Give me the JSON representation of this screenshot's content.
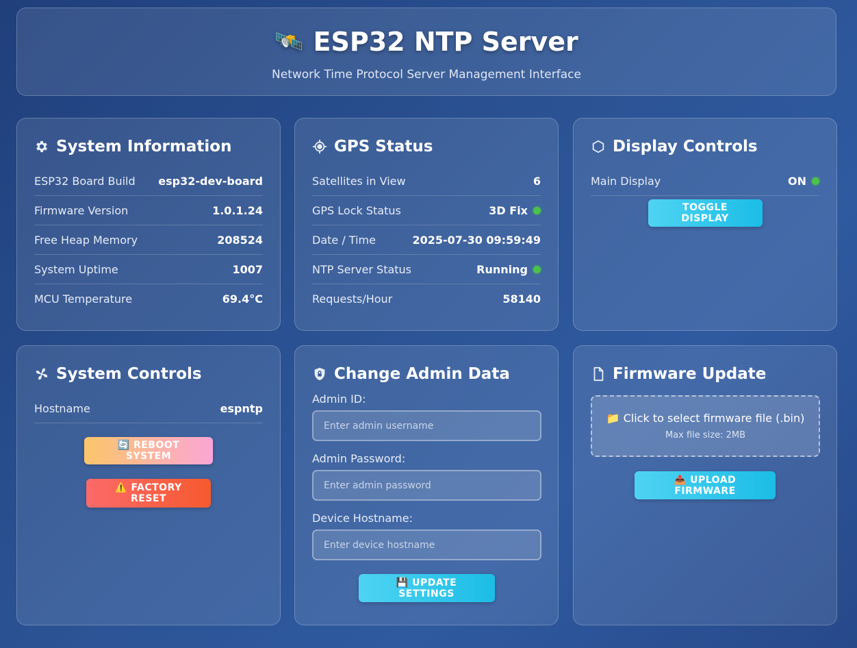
{
  "header": {
    "title": "ESP32 NTP Server",
    "icon": "satellite-icon",
    "subtitle": "Network Time Protocol Server Management Interface"
  },
  "system_info": {
    "title": "System Information",
    "icon": "gear-icon",
    "rows": [
      {
        "label": "ESP32 Board Build",
        "value": "esp32-dev-board"
      },
      {
        "label": "Firmware Version",
        "value": "1.0.1.24"
      },
      {
        "label": "Free Heap Memory",
        "value": "208524"
      },
      {
        "label": "System Uptime",
        "value": "1007"
      },
      {
        "label": "MCU Temperature",
        "value": "69.4°C"
      }
    ]
  },
  "gps_status": {
    "title": "GPS Status",
    "icon": "crosshair-icon",
    "rows": [
      {
        "label": "Satellites in View",
        "value": "6"
      },
      {
        "label": "GPS Lock Status",
        "value": "3D Fix",
        "status": "green"
      },
      {
        "label": "Date / Time",
        "value": "2025-07-30 09:59:49"
      },
      {
        "label": "NTP Server Status",
        "value": "Running",
        "status": "green"
      },
      {
        "label": "Requests/Hour",
        "value": "58140"
      }
    ]
  },
  "display_controls": {
    "title": "Display Controls",
    "icon": "hexagon-icon",
    "rows": [
      {
        "label": "Main Display",
        "value": "ON",
        "status": "green"
      }
    ],
    "toggle_label": "TOGGLE DISPLAY"
  },
  "system_controls": {
    "title": "System Controls",
    "icon": "fan-icon",
    "rows": [
      {
        "label": "Hostname",
        "value": "espntp"
      }
    ],
    "reboot_label": "🔄 REBOOT SYSTEM",
    "factory_reset_label": "⚠️ FACTORY RESET"
  },
  "admin_data": {
    "title": "Change Admin Data",
    "icon": "shield-lock-icon",
    "admin_id_label": "Admin ID:",
    "admin_id_placeholder": "Enter admin username",
    "admin_id_value": "",
    "password_label": "Admin Password:",
    "password_placeholder": "Enter admin password",
    "password_value": "",
    "hostname_label": "Device Hostname:",
    "hostname_placeholder": "Enter device hostname",
    "hostname_value": "",
    "update_label": "💾 UPDATE SETTINGS"
  },
  "firmware_update": {
    "title": "Firmware Update",
    "icon": "file-icon",
    "dropzone_text": "📁 Click to select firmware file (.bin)",
    "dropzone_sub": "Max file size: 2MB",
    "upload_label": "📤 UPLOAD FIRMWARE"
  },
  "colors": {
    "status_green": "#4cc24a",
    "accent_cyan": "#1bbde6",
    "danger_red": "#f55a2e"
  }
}
